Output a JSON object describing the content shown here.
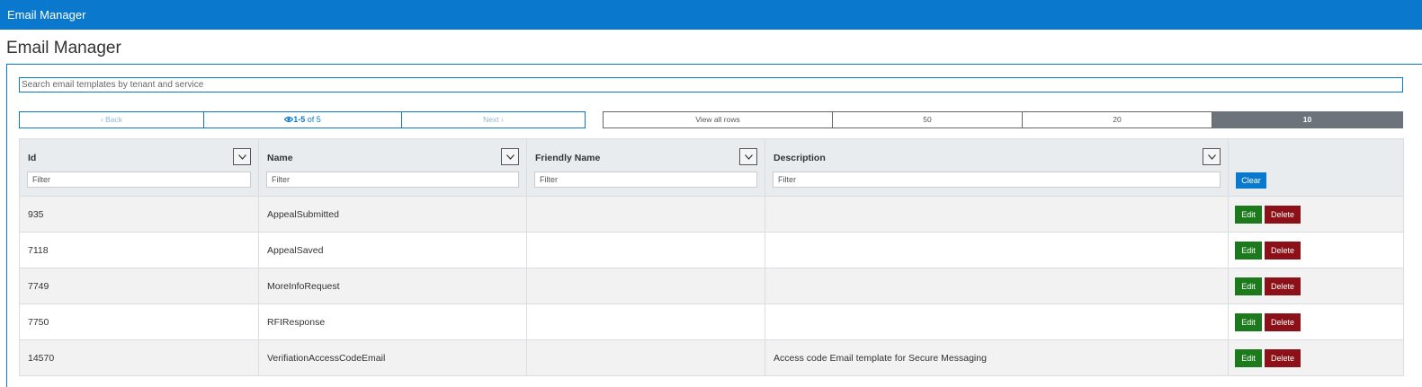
{
  "header": {
    "app_title": "Email Manager"
  },
  "page": {
    "title": "Email Manager"
  },
  "search": {
    "placeholder": "Search email templates by tenant and service"
  },
  "pager": {
    "back_label": "Back",
    "range_label": "1-5",
    "of_label": "of 5",
    "next_label": "Next"
  },
  "page_sizes": {
    "options": [
      "View all rows",
      "50",
      "20",
      "10"
    ],
    "selected": "10"
  },
  "table": {
    "columns": [
      {
        "label": "Id",
        "filter_placeholder": "Filter"
      },
      {
        "label": "Name",
        "filter_placeholder": "Filter"
      },
      {
        "label": "Friendly Name",
        "filter_placeholder": "Filter"
      },
      {
        "label": "Description",
        "filter_placeholder": "Filter"
      }
    ],
    "clear_label": "Clear",
    "edit_label": "Edit",
    "delete_label": "Delete",
    "rows": [
      {
        "id": "935",
        "name": "AppealSubmitted",
        "friendly_name": "",
        "description": ""
      },
      {
        "id": "7118",
        "name": "AppealSaved",
        "friendly_name": "",
        "description": ""
      },
      {
        "id": "7749",
        "name": "MoreInfoRequest",
        "friendly_name": "",
        "description": ""
      },
      {
        "id": "7750",
        "name": "RFIResponse",
        "friendly_name": "",
        "description": ""
      },
      {
        "id": "14570",
        "name": "VerifiationAccessCodeEmail",
        "friendly_name": "",
        "description": "Access code Email template for Secure Messaging"
      }
    ]
  },
  "colors": {
    "brand": "#0a78cc",
    "edit": "#1c7a1c",
    "delete": "#8b1018",
    "active_size": "#6c737b"
  }
}
